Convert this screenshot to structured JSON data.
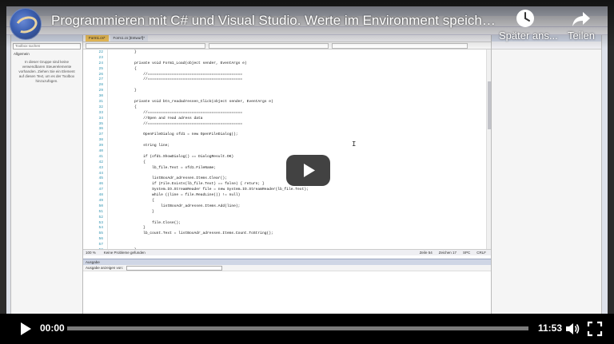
{
  "video": {
    "title": "Programmieren mit C# und Visual Studio. Werte im Environment speichern, Zeilen ...",
    "channel_icon": "channel-avatar"
  },
  "actions": {
    "watch_later": {
      "label": "Später ans...",
      "icon": "clock-icon"
    },
    "share": {
      "label": "Teilen",
      "icon": "share-icon"
    }
  },
  "controls": {
    "current_time": "00:00",
    "duration": "11:53",
    "progress_fraction": 0,
    "play_icon": "play-icon",
    "volume_icon": "volume-icon",
    "fullscreen_icon": "fullscreen-icon"
  },
  "colors": {
    "progress": "#ff0000",
    "play_button_bg": "#212121"
  },
  "ide": {
    "toolbox": {
      "search_placeholder": "Toolbox suchen",
      "group": "Allgemein",
      "hint": "In dieser Gruppe sind keine verwendbaren Steuerelemente vorhanden. Ziehen Sie ein Element auf diesen Text, um es der Toolbox hinzuzufügen."
    },
    "editor_tabs": [
      "Form1.cs*",
      "Form1.cs [Entwurf]*"
    ],
    "code_lines": [
      {
        "n": "22",
        "text": "        }"
      },
      {
        "n": "23",
        "text": ""
      },
      {
        "n": "24",
        "text": "        private void Form1_Load(object sender, EventArgs e)"
      },
      {
        "n": "25",
        "text": "        {"
      },
      {
        "n": "26",
        "text": "            //==========================================="
      },
      {
        "n": "27",
        "text": "            //==========================================="
      },
      {
        "n": "28",
        "text": ""
      },
      {
        "n": "29",
        "text": "        }"
      },
      {
        "n": "30",
        "text": ""
      },
      {
        "n": "31",
        "text": "        private void btn_readadressen_Click(object sender, EventArgs e)"
      },
      {
        "n": "32",
        "text": "        {"
      },
      {
        "n": "33",
        "text": "            //==========================================="
      },
      {
        "n": "34",
        "text": "            //Open and read adress data"
      },
      {
        "n": "35",
        "text": "            //==========================================="
      },
      {
        "n": "36",
        "text": ""
      },
      {
        "n": "37",
        "text": "            OpenFileDialog ofd1 = new OpenFileDialog();"
      },
      {
        "n": "38",
        "text": ""
      },
      {
        "n": "39",
        "text": "            string line;"
      },
      {
        "n": "40",
        "text": ""
      },
      {
        "n": "41",
        "text": "            if (ofd1.ShowDialog() == DialogResult.OK)"
      },
      {
        "n": "42",
        "text": "            {"
      },
      {
        "n": "43",
        "text": "                lb_file.Text = ofd1.FileName;"
      },
      {
        "n": "44",
        "text": ""
      },
      {
        "n": "45",
        "text": "                listBoxAdr_adressen.Items.Clear();"
      },
      {
        "n": "46",
        "text": "                if (File.Exists(lb_file.Text) == false) { return; }"
      },
      {
        "n": "47",
        "text": "                System.IO.StreamReader file = new System.IO.StreamReader(lb_file.Text);"
      },
      {
        "n": "48",
        "text": "                while ((line = file.ReadLine()) != null)"
      },
      {
        "n": "49",
        "text": "                {"
      },
      {
        "n": "50",
        "text": "                    listBoxAdr_adressen.Items.Add(line);"
      },
      {
        "n": "51",
        "text": "                }"
      },
      {
        "n": "52",
        "text": ""
      },
      {
        "n": "53",
        "text": "                file.Close();"
      },
      {
        "n": "54",
        "text": "            }"
      },
      {
        "n": "55",
        "text": "            lb_count.Text = listBoxAdr_adressen.Items.Count.ToString();"
      },
      {
        "n": "56",
        "text": ""
      },
      {
        "n": "57",
        "text": ""
      },
      {
        "n": "58",
        "text": "        }"
      },
      {
        "n": "59",
        "text": ""
      },
      {
        "n": "60",
        "text": "        private void button1_Click(object sender, EventArgs e)"
      },
      {
        "n": "61",
        "text": "        {"
      }
    ],
    "status": {
      "zoom": "100 %",
      "issues": "Keine Probleme gefunden",
      "line": "Zeile 54",
      "col": "Zeichen 17",
      "mode": "SPC",
      "eol": "CRLF"
    },
    "output": {
      "title": "Ausgabe",
      "show_from": "Ausgabe anzeigen von:"
    }
  }
}
